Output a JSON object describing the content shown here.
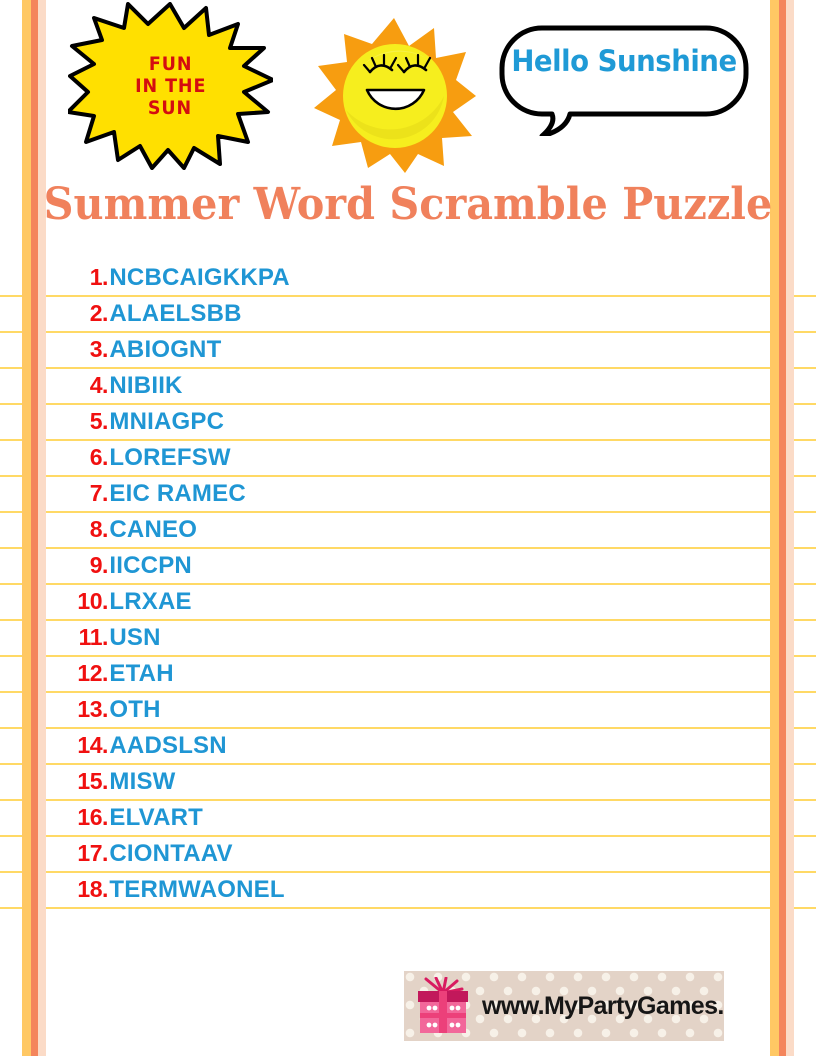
{
  "page": {
    "background": "#ffffff",
    "rule_color": "#ffd24a"
  },
  "header": {
    "burst": {
      "icon": "starburst-icon",
      "fill": "#ffe000",
      "outline": "#000000",
      "text_color": "#d40d10",
      "lines": [
        "FUN",
        "IN THE",
        "SUN"
      ]
    },
    "sun": {
      "icon": "smiling-sun-icon",
      "ray_color": "#f79d10",
      "face_color": "#f6ee1e"
    },
    "speech_bubble": {
      "icon": "speech-bubble-icon",
      "text": "Hello Sunshine",
      "text_color": "#1f9ad6",
      "fill": "#ffffff",
      "outline": "#000000"
    }
  },
  "title": {
    "text": "Summer Word Scramble Puzzle",
    "color": "#f0815c"
  },
  "border": {
    "stripe_colors": [
      "#ffc864",
      "#f4855c",
      "#fbdbc7"
    ]
  },
  "word_list": {
    "number_color": "#f01010",
    "word_color": "#1f96d4",
    "separator": ".",
    "items": [
      {
        "number": "1",
        "word": "NCBCAIGKKPA"
      },
      {
        "number": "2",
        "word": "ALAELSBB"
      },
      {
        "number": "3",
        "word": "ABIOGNT"
      },
      {
        "number": "4",
        "word": "NIBIIK"
      },
      {
        "number": "5",
        "word": "MNIAGPC"
      },
      {
        "number": "6",
        "word": "LOREFSW"
      },
      {
        "number": "7",
        "word": "EIC RAMEC"
      },
      {
        "number": "8",
        "word": "CANEO"
      },
      {
        "number": "9",
        "word": "IICCPN"
      },
      {
        "number": "10",
        "word": "LRXAE"
      },
      {
        "number": "11",
        "word": "USN"
      },
      {
        "number": "12",
        "word": "ETAH"
      },
      {
        "number": "13",
        "word": "OTH"
      },
      {
        "number": "14",
        "word": "AADSLSN"
      },
      {
        "number": "15",
        "word": "MISW"
      },
      {
        "number": "16",
        "word": "ELVART"
      },
      {
        "number": "17",
        "word": "CIONTAAV"
      },
      {
        "number": "18",
        "word": "TERMWAONEL"
      }
    ]
  },
  "footer": {
    "icon": "gift-box-icon",
    "url": "www.MyPartyGames.com",
    "background": "#e3d3c7",
    "dot_color": "#f7f1e8",
    "gift_color": "#f2679a",
    "gift_ribbon_color": "#c2185b"
  }
}
